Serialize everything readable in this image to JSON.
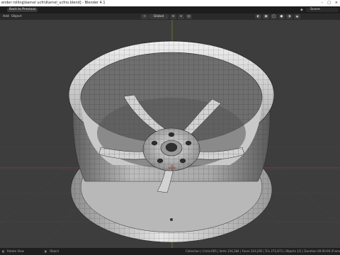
{
  "window": {
    "title": "ender rolling\\karnel ucfn\\Karnel_ucfno.blend] - Blender 4.1"
  },
  "top_header": {
    "back_label": "Back to Previous",
    "scene_label": "Scene"
  },
  "viewport_header": {
    "menu": [
      "Add",
      "Object"
    ],
    "orientation": "Global"
  },
  "status_bar": {
    "left_hint": "Rotate View",
    "mid_hint": "Object",
    "stats": "Collection | Circle.005 | Verts 316,284 | Faces 316,292 | Tris 272,873 | Objects 1/2 | Duration 00:00:00 (Frame 1) | 4.1"
  },
  "colors": {
    "viewport_bg": "#3d3d3d",
    "grid": "#474747",
    "x_axis": "#8a3a46",
    "y_axis": "#7a8a2a",
    "wire": "#262626",
    "surface_light": "#d7d7d7",
    "surface_dark": "#6a6a6a"
  }
}
